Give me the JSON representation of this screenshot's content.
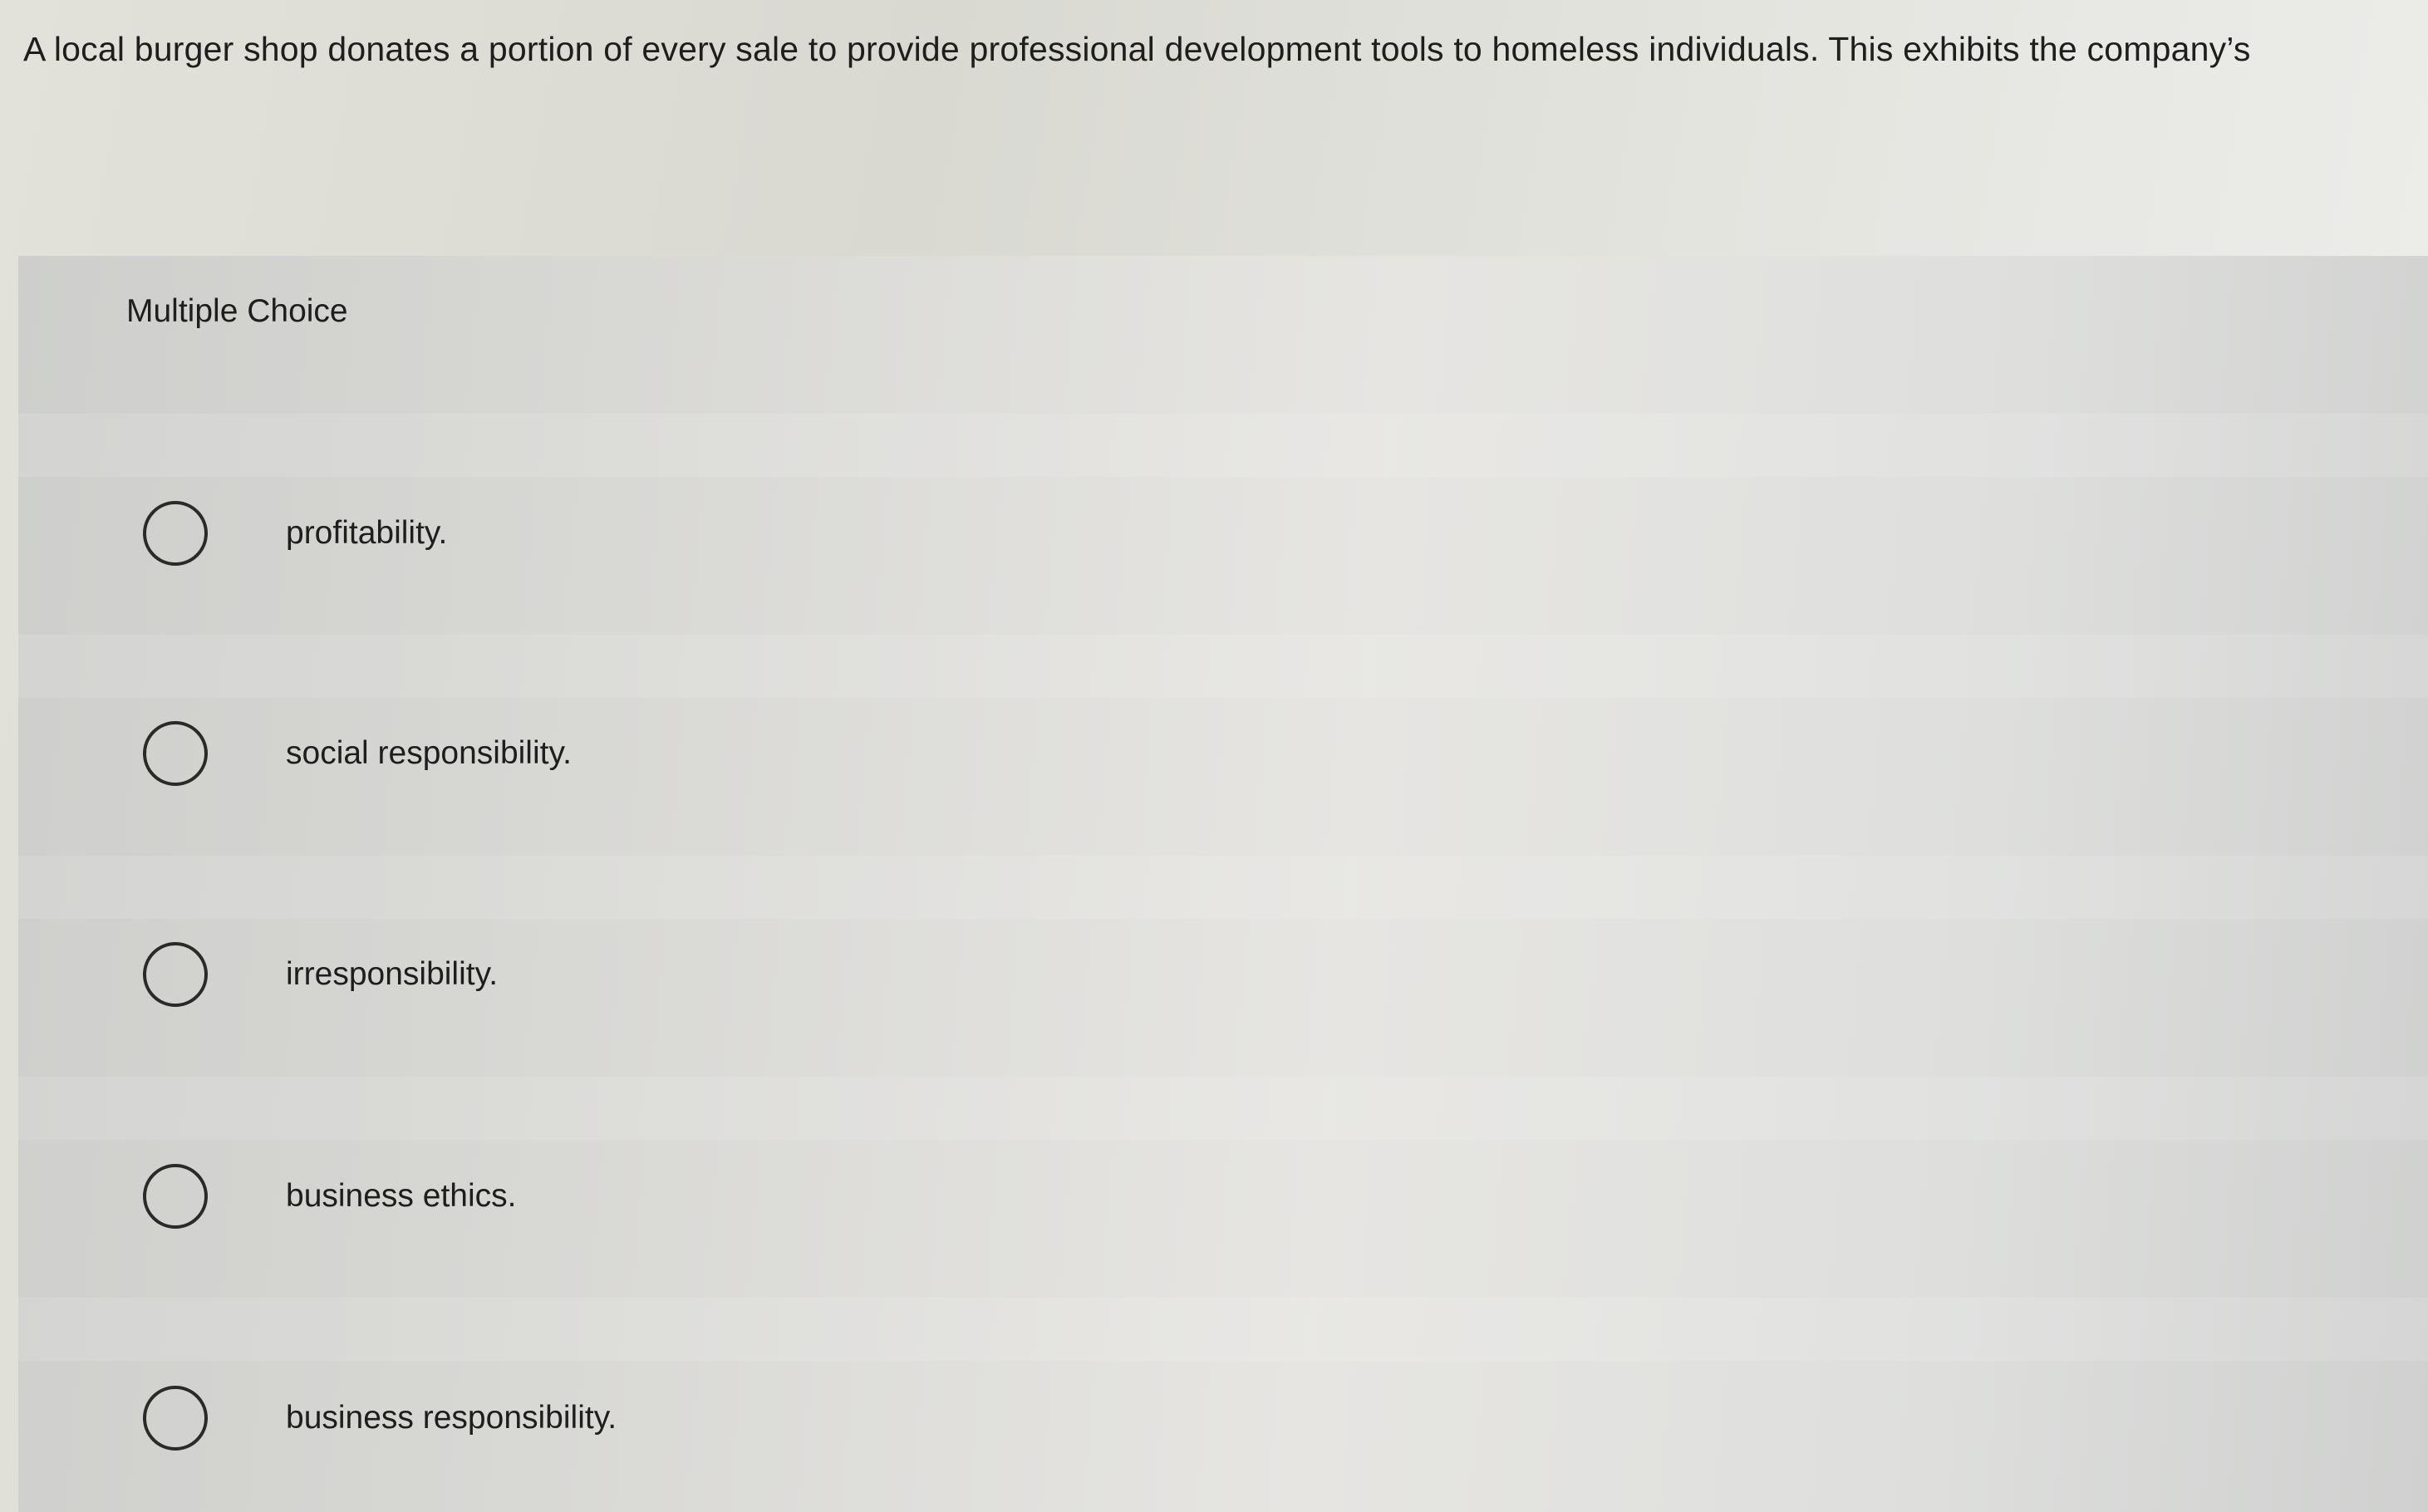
{
  "question": {
    "text": "A local burger shop donates a portion of every sale to provide professional development tools to homeless individuals. This exhibits the company’s"
  },
  "panel": {
    "label": "Multiple Choice"
  },
  "options": [
    {
      "label": "profitability.",
      "selected": false
    },
    {
      "label": "social responsibility.",
      "selected": false
    },
    {
      "label": "irresponsibility.",
      "selected": false
    },
    {
      "label": "business ethics.",
      "selected": false
    },
    {
      "label": "business responsibility.",
      "selected": false
    }
  ]
}
